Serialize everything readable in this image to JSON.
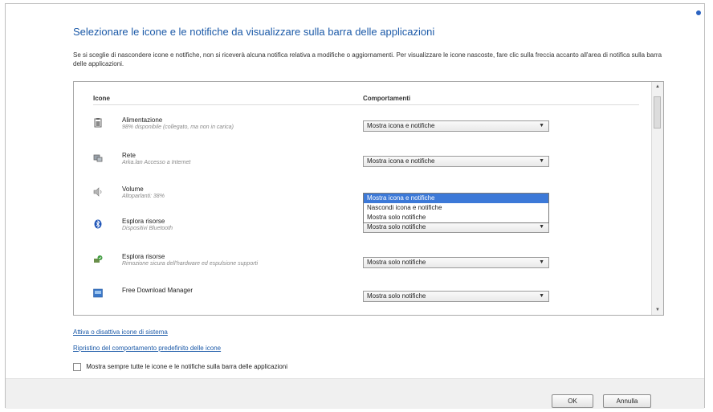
{
  "dialog": {
    "title": "Selezionare le icone e le notifiche da visualizzare sulla barra delle applicazioni",
    "description": "Se si sceglie di nascondere icone e notifiche, non si riceverà alcuna notifica relativa a modifiche o aggiornamenti. Per visualizzare le icone nascoste, fare clic sulla freccia accanto all'area di notifica sulla barra delle applicazioni.",
    "headers": {
      "icons": "Icone",
      "behaviors": "Comportamenti"
    },
    "rows": [
      {
        "icon": "battery-icon",
        "name": "Alimentazione",
        "sub": "98% disponibile (collegato, ma non in carica)",
        "behavior": "Mostra icona e notifiche"
      },
      {
        "icon": "network-icon",
        "name": "Rete",
        "sub": "Arka.lan Accesso a Internet",
        "behavior": "Mostra icona e notifiche"
      },
      {
        "icon": "speaker-icon",
        "name": "Volume",
        "sub": "Altoparlanti: 38%",
        "behavior": ""
      },
      {
        "icon": "bluetooth-icon",
        "name": "Esplora risorse",
        "sub": "Dispositivi Bluetooth",
        "behavior": "Mostra solo notifiche"
      },
      {
        "icon": "safe-remove-icon",
        "name": "Esplora risorse",
        "sub": "Rimozione sicura dell'hardware ed espulsione supporti",
        "behavior": "Mostra solo notifiche"
      },
      {
        "icon": "download-manager-icon",
        "name": "Free Download Manager",
        "sub": "",
        "behavior": "Mostra solo notifiche"
      }
    ],
    "dropdown_options": [
      "Mostra icona e notifiche",
      "Nascondi icona e notifiche",
      "Mostra solo notifiche"
    ],
    "dropdown_selected_index": 0,
    "links": {
      "toggle_system_icons": "Attiva o disattiva icone di sistema",
      "restore_defaults": "Ripristino del comportamento predefinito delle icone"
    },
    "always_show_label": "Mostra sempre tutte le icone e le notifiche sulla barra delle applicazioni",
    "always_show_checked": false,
    "buttons": {
      "ok": "OK",
      "cancel": "Annulla"
    }
  }
}
